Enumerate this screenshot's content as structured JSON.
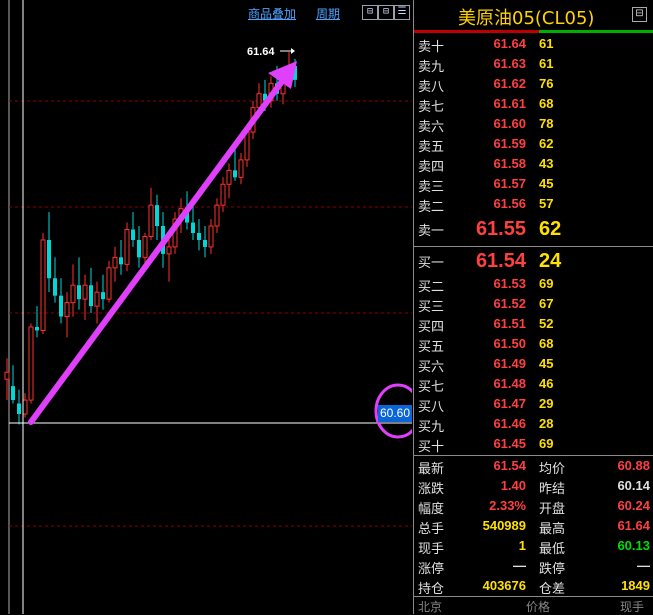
{
  "toolbar": {
    "overlay_label": "商品叠加",
    "period_label": "周期",
    "btn_prev": "⊟",
    "btn_next": "⊟",
    "btn_menu": "☰"
  },
  "chart": {
    "arrow_label": "61.64",
    "price_tag": "60.60",
    "colors": {
      "up": "#ff3030",
      "down": "#00d8d8",
      "arrow": "#e040fb",
      "grid": "#8b0000"
    },
    "candles": [
      {
        "o": 60.7,
        "h": 60.76,
        "l": 60.64,
        "c": 60.72
      },
      {
        "o": 60.68,
        "h": 60.74,
        "l": 60.63,
        "c": 60.64
      },
      {
        "o": 60.63,
        "h": 60.67,
        "l": 60.57,
        "c": 60.6
      },
      {
        "o": 60.6,
        "h": 60.66,
        "l": 60.59,
        "c": 60.64
      },
      {
        "o": 60.64,
        "h": 60.86,
        "l": 60.63,
        "c": 60.85
      },
      {
        "o": 60.85,
        "h": 60.91,
        "l": 60.82,
        "c": 60.84
      },
      {
        "o": 60.84,
        "h": 61.12,
        "l": 60.83,
        "c": 61.1
      },
      {
        "o": 61.1,
        "h": 61.18,
        "l": 60.95,
        "c": 60.99
      },
      {
        "o": 60.99,
        "h": 61.05,
        "l": 60.92,
        "c": 60.94
      },
      {
        "o": 60.94,
        "h": 60.99,
        "l": 60.86,
        "c": 60.88
      },
      {
        "o": 60.88,
        "h": 60.95,
        "l": 60.82,
        "c": 60.92
      },
      {
        "o": 60.92,
        "h": 61.03,
        "l": 60.88,
        "c": 60.97
      },
      {
        "o": 60.97,
        "h": 61.05,
        "l": 60.9,
        "c": 60.93
      },
      {
        "o": 60.93,
        "h": 61.0,
        "l": 60.87,
        "c": 60.97
      },
      {
        "o": 60.97,
        "h": 61.02,
        "l": 60.89,
        "c": 60.91
      },
      {
        "o": 60.91,
        "h": 60.98,
        "l": 60.86,
        "c": 60.95
      },
      {
        "o": 60.95,
        "h": 61.0,
        "l": 60.9,
        "c": 60.93
      },
      {
        "o": 60.93,
        "h": 61.04,
        "l": 60.92,
        "c": 61.02
      },
      {
        "o": 61.02,
        "h": 61.08,
        "l": 60.98,
        "c": 61.05
      },
      {
        "o": 61.05,
        "h": 61.1,
        "l": 61.0,
        "c": 61.03
      },
      {
        "o": 61.03,
        "h": 61.15,
        "l": 61.01,
        "c": 61.13
      },
      {
        "o": 61.13,
        "h": 61.18,
        "l": 61.08,
        "c": 61.1
      },
      {
        "o": 61.1,
        "h": 61.14,
        "l": 61.02,
        "c": 61.05
      },
      {
        "o": 61.05,
        "h": 61.12,
        "l": 61.03,
        "c": 61.11
      },
      {
        "o": 61.11,
        "h": 61.25,
        "l": 61.1,
        "c": 61.2
      },
      {
        "o": 61.2,
        "h": 61.23,
        "l": 61.1,
        "c": 61.14
      },
      {
        "o": 61.14,
        "h": 61.18,
        "l": 61.02,
        "c": 61.06
      },
      {
        "o": 61.06,
        "h": 61.12,
        "l": 60.98,
        "c": 61.08
      },
      {
        "o": 61.08,
        "h": 61.18,
        "l": 61.06,
        "c": 61.16
      },
      {
        "o": 61.16,
        "h": 61.22,
        "l": 61.12,
        "c": 61.19
      },
      {
        "o": 61.19,
        "h": 61.24,
        "l": 61.13,
        "c": 61.15
      },
      {
        "o": 61.15,
        "h": 61.2,
        "l": 61.1,
        "c": 61.12
      },
      {
        "o": 61.12,
        "h": 61.16,
        "l": 61.07,
        "c": 61.1
      },
      {
        "o": 61.1,
        "h": 61.14,
        "l": 61.05,
        "c": 61.08
      },
      {
        "o": 61.08,
        "h": 61.16,
        "l": 61.06,
        "c": 61.14
      },
      {
        "o": 61.14,
        "h": 61.22,
        "l": 61.12,
        "c": 61.2
      },
      {
        "o": 61.2,
        "h": 61.28,
        "l": 61.18,
        "c": 61.26
      },
      {
        "o": 61.26,
        "h": 61.32,
        "l": 61.22,
        "c": 61.3
      },
      {
        "o": 61.3,
        "h": 61.36,
        "l": 61.27,
        "c": 61.28
      },
      {
        "o": 61.28,
        "h": 61.35,
        "l": 61.26,
        "c": 61.33
      },
      {
        "o": 61.33,
        "h": 61.43,
        "l": 61.31,
        "c": 61.41
      },
      {
        "o": 61.41,
        "h": 61.5,
        "l": 61.39,
        "c": 61.48
      },
      {
        "o": 61.48,
        "h": 61.55,
        "l": 61.45,
        "c": 61.52
      },
      {
        "o": 61.52,
        "h": 61.56,
        "l": 61.47,
        "c": 61.5
      },
      {
        "o": 61.5,
        "h": 61.57,
        "l": 61.48,
        "c": 61.55
      },
      {
        "o": 61.55,
        "h": 61.6,
        "l": 61.5,
        "c": 61.52
      },
      {
        "o": 61.52,
        "h": 61.58,
        "l": 61.49,
        "c": 61.56
      },
      {
        "o": 61.56,
        "h": 61.64,
        "l": 61.54,
        "c": 61.6
      },
      {
        "o": 61.6,
        "h": 61.62,
        "l": 61.54,
        "c": 61.56
      }
    ]
  },
  "panel": {
    "title": "美原油05(CL05)",
    "title_icon": "⊟",
    "sell": [
      {
        "label": "卖十",
        "price": "61.64",
        "vol": "61"
      },
      {
        "label": "卖九",
        "price": "61.63",
        "vol": "61"
      },
      {
        "label": "卖八",
        "price": "61.62",
        "vol": "76"
      },
      {
        "label": "卖七",
        "price": "61.61",
        "vol": "68"
      },
      {
        "label": "卖六",
        "price": "61.60",
        "vol": "78"
      },
      {
        "label": "卖五",
        "price": "61.59",
        "vol": "62"
      },
      {
        "label": "卖四",
        "price": "61.58",
        "vol": "43"
      },
      {
        "label": "卖三",
        "price": "61.57",
        "vol": "45"
      },
      {
        "label": "卖二",
        "price": "61.56",
        "vol": "57"
      },
      {
        "label": "卖一",
        "price": "61.55",
        "vol": "62"
      }
    ],
    "buy": [
      {
        "label": "买一",
        "price": "61.54",
        "vol": "24"
      },
      {
        "label": "买二",
        "price": "61.53",
        "vol": "69"
      },
      {
        "label": "买三",
        "price": "61.52",
        "vol": "67"
      },
      {
        "label": "买四",
        "price": "61.51",
        "vol": "52"
      },
      {
        "label": "买五",
        "price": "61.50",
        "vol": "68"
      },
      {
        "label": "买六",
        "price": "61.49",
        "vol": "45"
      },
      {
        "label": "买七",
        "price": "61.48",
        "vol": "46"
      },
      {
        "label": "买八",
        "price": "61.47",
        "vol": "29"
      },
      {
        "label": "买九",
        "price": "61.46",
        "vol": "28"
      },
      {
        "label": "买十",
        "price": "61.45",
        "vol": "69"
      }
    ],
    "stats": [
      {
        "l1": "最新",
        "v1": "61.54",
        "c1": "red",
        "l2": "均价",
        "v2": "60.88",
        "c2": "red"
      },
      {
        "l1": "涨跌",
        "v1": "1.40",
        "c1": "red",
        "l2": "昨结",
        "v2": "60.14",
        "c2": "wht"
      },
      {
        "l1": "幅度",
        "v1": "2.33%",
        "c1": "red",
        "l2": "开盘",
        "v2": "60.24",
        "c2": "red"
      },
      {
        "l1": "总手",
        "v1": "540989",
        "c1": "yel",
        "l2": "最高",
        "v2": "61.64",
        "c2": "red"
      },
      {
        "l1": "现手",
        "v1": "1",
        "c1": "yel",
        "l2": "最低",
        "v2": "60.13",
        "c2": "grn"
      },
      {
        "l1": "涨停",
        "v1": "—",
        "c1": "wht",
        "l2": "跌停",
        "v2": "—",
        "c2": "wht"
      },
      {
        "l1": "持仓",
        "v1": "403676",
        "c1": "yel",
        "l2": "仓差",
        "v2": "1849",
        "c2": "yel"
      }
    ],
    "footer": {
      "col1": "北京",
      "col2": "价格",
      "col3": "现手"
    }
  }
}
